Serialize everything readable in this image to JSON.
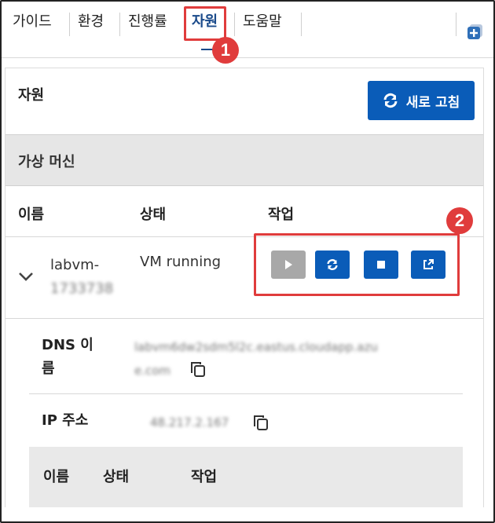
{
  "tabs": {
    "guide": "가이드",
    "environment": "환경",
    "progress": "진행률",
    "resources": "자원",
    "help": "도움말"
  },
  "callouts": [
    "1",
    "2"
  ],
  "panel": {
    "title": "자원",
    "refresh_label": "새로 고침"
  },
  "vm_section": {
    "title": "가상 머신",
    "columns": [
      "이름",
      "상태",
      "작업"
    ],
    "row": {
      "name": "labvm-",
      "name_suffix_redacted": "1733738",
      "status": "VM running",
      "actions": [
        "play-icon",
        "restart-icon",
        "stop-icon",
        "open-external-icon"
      ]
    },
    "details": {
      "dns_label_line1": "DNS 이",
      "dns_label_line2": "름",
      "dns_value_line1": "labvm6dw2sdm5l2c.eastus.cloudapp.azu",
      "dns_value_line2": "e.com",
      "ip_label": "IP 주소",
      "ip_value": "48.217.2.167"
    },
    "subtable_columns": [
      "이름",
      "상태",
      "작업"
    ]
  },
  "colors": {
    "accent": "#0a5cb8",
    "active_tab": "#1a4a8a",
    "callout": "#e03c3c",
    "section_bg": "#e6e6e6"
  }
}
